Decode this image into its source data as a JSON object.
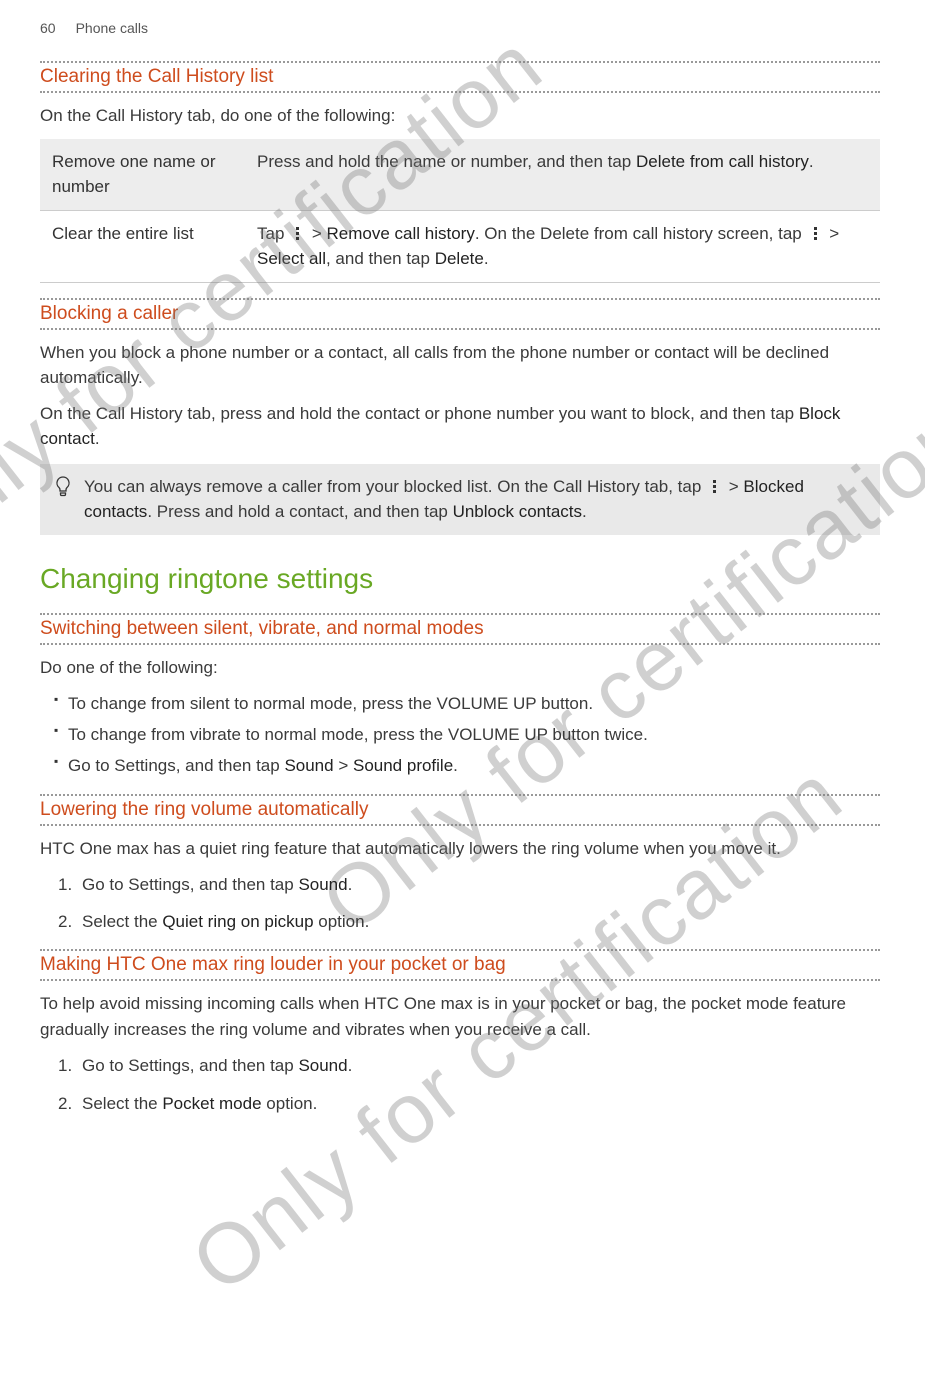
{
  "header": {
    "page": "60",
    "section": "Phone calls"
  },
  "watermark": "Only for certification",
  "s1": {
    "title": "Clearing the Call History list",
    "intro": "On the Call History tab, do one of the following:",
    "table": {
      "r1c1": "Remove one name or number",
      "r1c2a": "Press and hold the name or number, and then tap ",
      "r1c2b": "Delete from call history",
      "r1c2c": ".",
      "r2c1": "Clear the entire list",
      "r2c2a": "Tap ",
      "r2c2b": " > ",
      "r2c2c": "Remove call history",
      "r2c2d": ". On the Delete from call history screen, tap ",
      "r2c2e": " > ",
      "r2c2f": "Select all",
      "r2c2g": ", and then tap ",
      "r2c2h": "Delete",
      "r2c2i": "."
    }
  },
  "s2": {
    "title": "Blocking a caller",
    "p1": "When you block a phone number or a contact, all calls from the phone number or contact will be declined automatically.",
    "p2a": "On the Call History tab, press and hold the contact or phone number you want to block, and then tap ",
    "p2b": "Block contact",
    "p2c": ".",
    "tipa": "You can always remove a caller from your blocked list. On the Call History tab, tap ",
    "tipb": " > ",
    "tipc": "Blocked contacts",
    "tipd": ". Press and hold a contact, and then tap ",
    "tipe": "Unblock contacts",
    "tipf": "."
  },
  "s3": {
    "title": "Changing ringtone settings"
  },
  "s4": {
    "title": "Switching between silent, vibrate, and normal modes",
    "intro": "Do one of the following:",
    "b1": "To change from silent to normal mode, press the VOLUME UP button.",
    "b2": "To change from vibrate to normal mode, press the VOLUME UP button twice.",
    "b3a": "Go to Settings, and then tap ",
    "b3b": "Sound",
    "b3c": " > ",
    "b3d": "Sound profile",
    "b3e": "."
  },
  "s5": {
    "title": "Lowering the ring volume automatically",
    "p1": "HTC One max has a quiet ring feature that automatically lowers the ring volume when you move it.",
    "l1a": "Go to Settings, and then tap ",
    "l1b": "Sound",
    "l1c": ".",
    "l2a": "Select the ",
    "l2b": "Quiet ring on pickup",
    "l2c": " option."
  },
  "s6": {
    "title": "Making HTC One max ring louder in your pocket or bag",
    "p1": "To help avoid missing incoming calls when HTC One max is in your pocket or bag, the pocket mode feature gradually increases the ring volume and vibrates when you receive a call.",
    "l1a": "Go to Settings, and then tap ",
    "l1b": "Sound",
    "l1c": ".",
    "l2a": "Select the ",
    "l2b": "Pocket mode",
    "l2c": " option."
  }
}
